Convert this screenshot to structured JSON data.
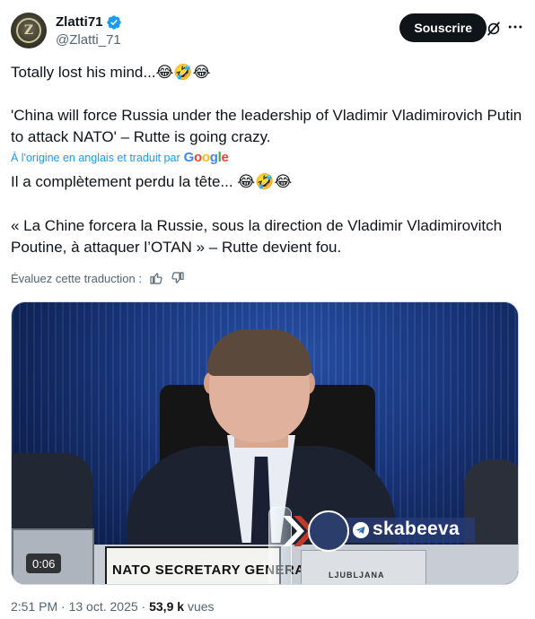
{
  "author": {
    "display_name": "Zlatti71",
    "handle": "@Zlatti_71",
    "avatar_letter": "Z",
    "verified_icon": "verified-badge-icon"
  },
  "actions": {
    "subscribe_label": "Souscrire",
    "grok_icon": "grok-icon",
    "more_icon": "more-options-icon"
  },
  "post": {
    "original_line1": "Totally lost his mind...😂🤣😂",
    "original_line2": "'China will force Russia under the leadership of Vladimir Vladimirovich Putin to attack NATO' – Rutte is going crazy.",
    "translated_note": "À l'origine en anglais et traduit par",
    "translator": "Google",
    "translated_line1": "Il a complètement perdu la tête... 😂🤣😂",
    "translated_line2": "« La Chine forcera la Russie, sous la direction de Vladimir Vladimirovitch Poutine, à attaquer l’OTAN » – Rutte devient fou.",
    "rate_label": "Évaluez cette traduction :"
  },
  "media": {
    "placard_text": "NATO SECRETARY GENERAL",
    "logo_text": "LJUBLJANA",
    "watermark": "skabeeva",
    "duration": "0:06"
  },
  "meta": {
    "time": "2:51 PM",
    "date": "13 oct. 2025",
    "views_count": "53,9 k",
    "views_label": "vues"
  },
  "colors": {
    "accent": "#1d9bf0",
    "text": "#0f1419",
    "secondary": "#536471",
    "button": "#0f1419"
  }
}
